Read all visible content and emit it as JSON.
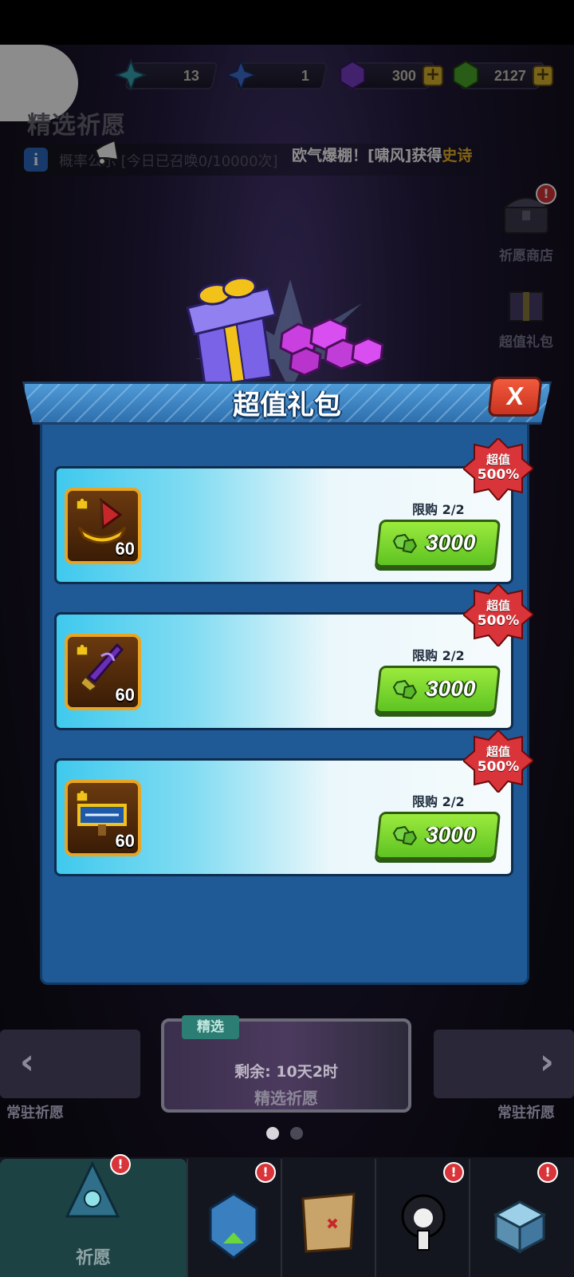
{
  "currencies": [
    {
      "name": "star-blue-green",
      "value": "13"
    },
    {
      "name": "star-blue",
      "value": "1"
    },
    {
      "name": "purple-gem",
      "value": "300"
    },
    {
      "name": "green-gem",
      "value": "2127"
    }
  ],
  "page": {
    "title": "精选祈愿",
    "info_text": "概率公示 [今日已召唤0/10000次]",
    "ticker_prefix": "欧气爆棚！[啸风]获得",
    "ticker_highlight": "史诗"
  },
  "side_buttons": [
    {
      "label": "祈愿商店"
    },
    {
      "label": "超值礼包"
    }
  ],
  "modal": {
    "title": "超值礼包",
    "close": "X",
    "packs": [
      {
        "item": "golden-boat",
        "count": "60",
        "limit": "限购 2/2",
        "price": "3000",
        "badge_top": "超值",
        "badge_bottom": "500%"
      },
      {
        "item": "purple-dagger",
        "count": "60",
        "limit": "限购 2/2",
        "price": "3000",
        "badge_top": "超值",
        "badge_bottom": "500%"
      },
      {
        "item": "plaque",
        "count": "60",
        "limit": "限购 2/2",
        "price": "3000",
        "badge_top": "超值",
        "badge_bottom": "500%"
      }
    ]
  },
  "carousel": {
    "left_label": "常驻祈愿",
    "right_label": "常驻祈愿",
    "featured_tag": "精选",
    "featured_remaining": "剩余: 10天2时",
    "featured_name": "精选祈愿"
  },
  "nav": {
    "items": [
      {
        "label": "祈愿",
        "active": true
      },
      {
        "label": ""
      },
      {
        "label": ""
      },
      {
        "label": ""
      },
      {
        "label": ""
      }
    ]
  },
  "colors": {
    "accent_green": "#5ec322",
    "badge_red": "#d8343a",
    "modal_blue": "#1f5a97",
    "close_red": "#d43a24"
  }
}
